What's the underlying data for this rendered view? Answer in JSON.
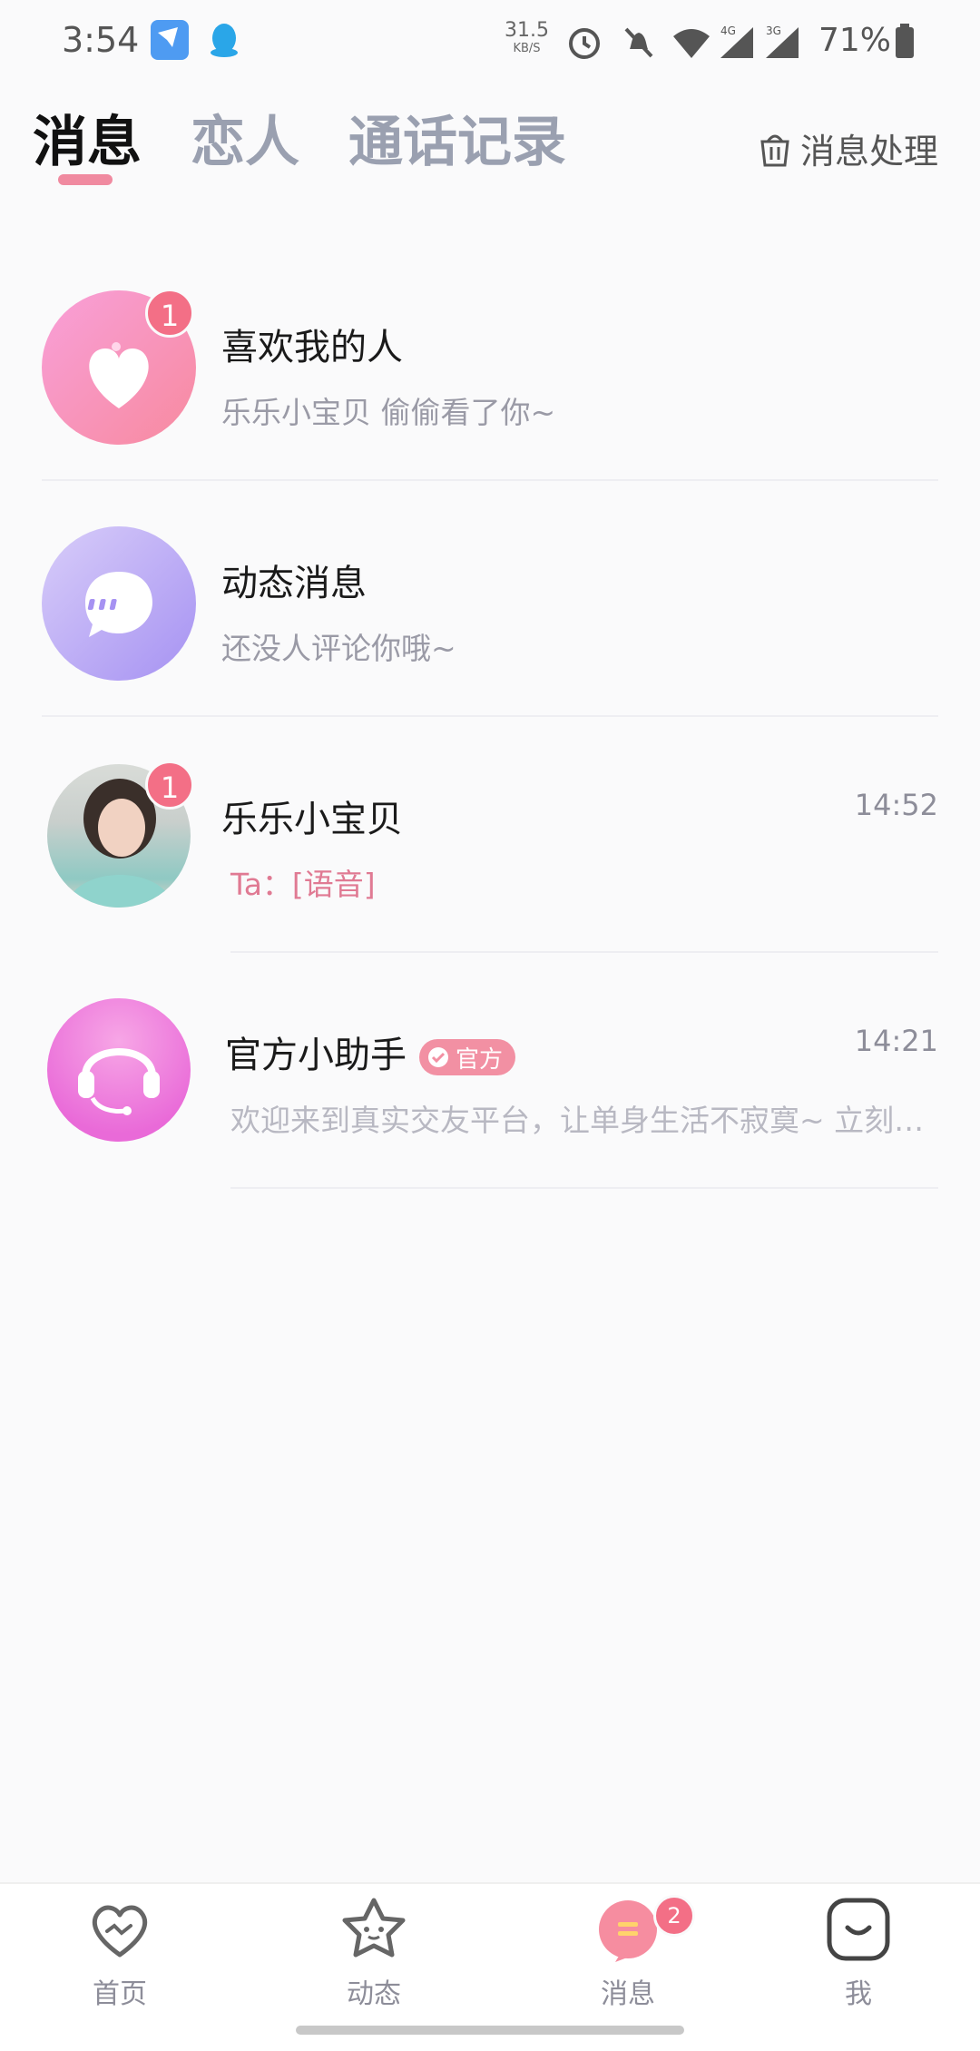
{
  "status_bar": {
    "time": "3:54",
    "net_speed": "31.5",
    "net_unit": "KB/S",
    "signal_1": "4G",
    "signal_2": "3G",
    "battery": "71%"
  },
  "header": {
    "tabs": [
      {
        "label": "消息",
        "active": true
      },
      {
        "label": "恋人",
        "active": false
      },
      {
        "label": "通话记录",
        "active": false
      }
    ],
    "manage_label": "消息处理"
  },
  "messages": [
    {
      "title": "喜欢我的人",
      "preview": "乐乐小宝贝 偷偷看了你~",
      "time": "",
      "badge": "1",
      "icon": "heart-icon"
    },
    {
      "title": "动态消息",
      "preview": "还没人评论你哦~",
      "time": "",
      "badge": "",
      "icon": "chat-bubble-icon"
    },
    {
      "title": "乐乐小宝贝",
      "preview_prefix": "Ta：",
      "preview": "[语音]",
      "time": "14:52",
      "badge": "1",
      "icon": "avatar-photo"
    },
    {
      "title": "官方小助手",
      "tag": "官方",
      "preview": "欢迎来到真实交友平台，让单身生活不寂寞~ 立刻…",
      "time": "14:21",
      "badge": "",
      "icon": "headset-icon"
    }
  ],
  "bottom_nav": {
    "items": [
      {
        "label": "首页",
        "icon": "home-heart-icon"
      },
      {
        "label": "动态",
        "icon": "star-face-icon"
      },
      {
        "label": "消息",
        "icon": "message-icon",
        "badge": "2",
        "active": true
      },
      {
        "label": "我",
        "icon": "smile-face-icon"
      }
    ]
  },
  "colors": {
    "accent_pink": "#f36f86",
    "badge": "#f36f86",
    "tab_inactive": "#9aa0b0",
    "voice_text": "#e07a93"
  }
}
